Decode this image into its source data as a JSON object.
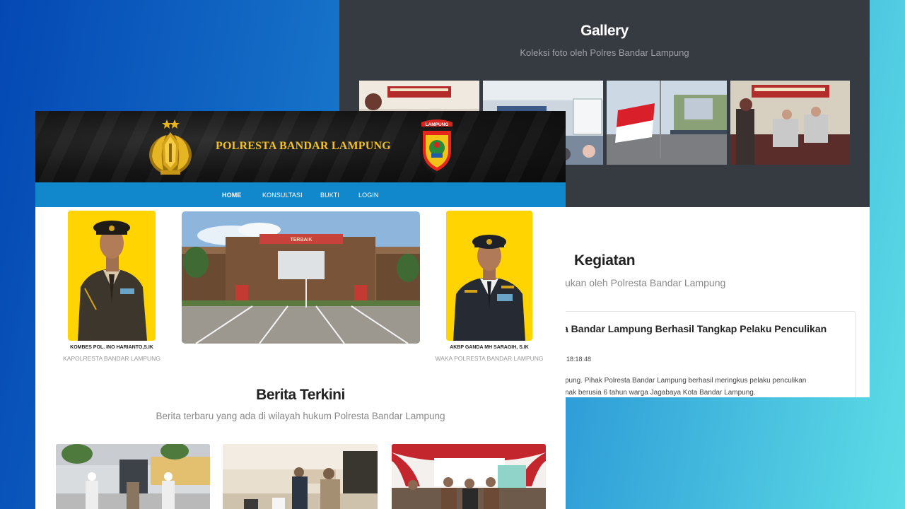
{
  "gallery": {
    "title": "Gallery",
    "subtitle": "Koleksi foto oleh Polres Bandar Lampung"
  },
  "kegiatan": {
    "title": "Kegiatan",
    "subtitle": "ukan oleh Polresta Bandar Lampung",
    "article": {
      "headline": "a Bandar Lampung Berhasil Tangkap Pelaku Penculikan",
      "time": "18:18:48",
      "excerpt_line1": "pung. Pihak Polresta Bandar Lampung berhasil meringkus pelaku penculikan",
      "excerpt_line2": "nak berusia 6 tahun warga Jagabaya Kota Bandar Lampung."
    }
  },
  "site": {
    "title": "POLRESTA BANDAR LAMPUNG",
    "logo_left": "tribrata-emblem",
    "logo_right_text": "LAMPUNG"
  },
  "nav": {
    "items": [
      "HOME",
      "KONSULTASI",
      "BUKTI",
      "LOGIN"
    ],
    "active": "HOME"
  },
  "officers": [
    {
      "name": "KOMBES POL. INO HARIANTO,S.IK",
      "role": "KAPOLRESTA BANDAR LAMPUNG"
    },
    {
      "name": "AKBP GANDA MH SARAGIH, S.IK",
      "role": "WAKA POLRESTA BANDAR LAMPUNG"
    }
  ],
  "berita": {
    "title": "Berita Terkini",
    "subtitle": "Berita terbaru yang ada di wilayah hukum Polresta Bandar Lampung"
  },
  "hq_sign": "TERBAIK",
  "colors": {
    "nav_blue": "#1187cc",
    "gallery_bg": "#363a41",
    "officer_bg": "#ffd400",
    "title_gold": "#f2c028"
  }
}
